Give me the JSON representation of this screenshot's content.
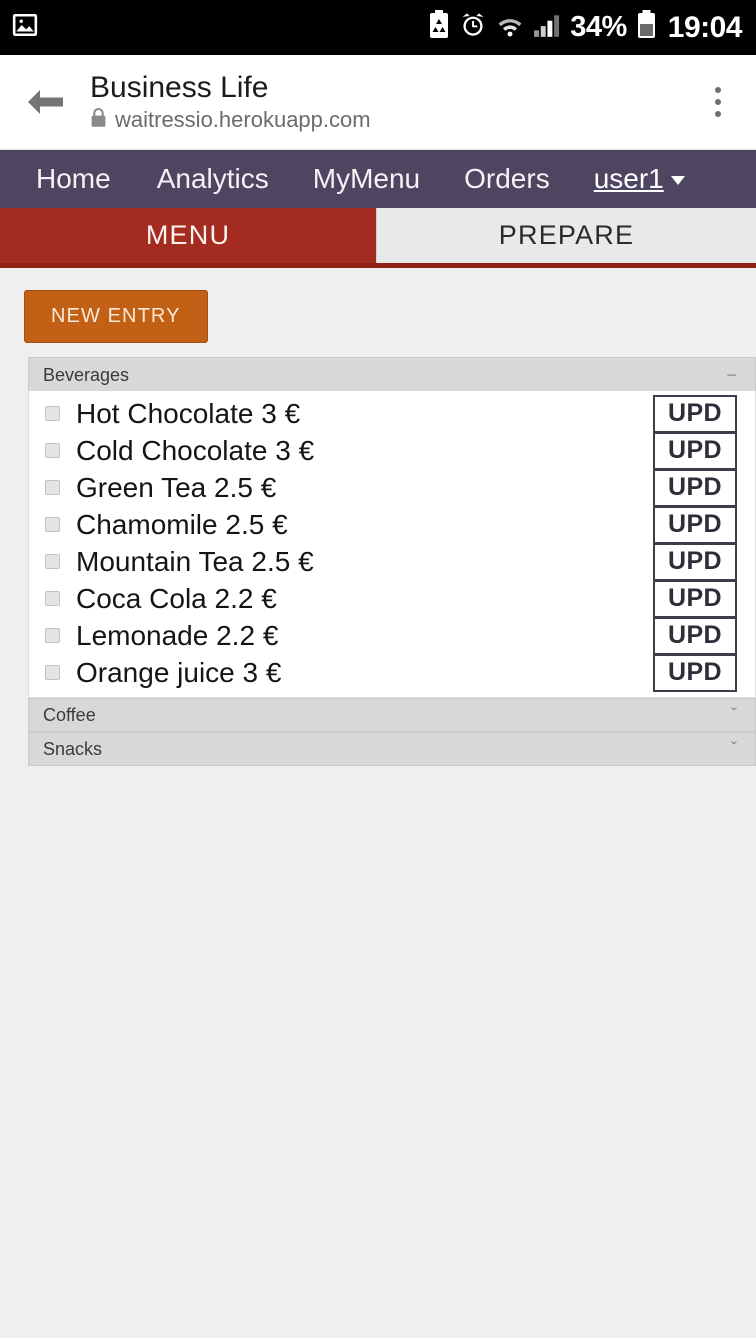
{
  "statusbar": {
    "left_icons": [
      "photo-icon"
    ],
    "battery_saver_icon": "battery-saver-icon",
    "alarm_icon": "alarm-clock-icon",
    "wifi_icon": "wifi-icon",
    "signal_icon": "signal-bars-icon",
    "battery_percent": "34%",
    "battery_icon": "battery-icon",
    "clock": "19:04"
  },
  "browser": {
    "back_icon": "back-arrow-icon",
    "title": "Business Life",
    "lock_icon": "lock-icon",
    "url": "waitressio.herokuapp.com",
    "overflow_icon": "overflow-menu-icon"
  },
  "nav": {
    "items": [
      {
        "label": "Home"
      },
      {
        "label": "Analytics"
      },
      {
        "label": "MyMenu"
      },
      {
        "label": "Orders"
      }
    ],
    "user": {
      "label": "user1",
      "caret_icon": "caret-down-icon"
    },
    "background_color": "#4e4560"
  },
  "tabs": {
    "active_color": "#a42b20",
    "inactive_color": "#e9e9e9",
    "items": [
      {
        "label": "MENU",
        "active": true
      },
      {
        "label": "PREPARE",
        "active": false
      }
    ]
  },
  "toolbar": {
    "new_entry_label": "NEW ENTRY",
    "new_entry_color": "#c26016"
  },
  "panels": [
    {
      "title": "Beverages",
      "expanded": true,
      "toggle_sign": "−",
      "items": [
        {
          "label": "Hot Chocolate 3 €",
          "checked": false,
          "action": "UPD"
        },
        {
          "label": "Cold Chocolate 3 €",
          "checked": false,
          "action": "UPD"
        },
        {
          "label": "Green Tea 2.5 €",
          "checked": false,
          "action": "UPD"
        },
        {
          "label": "Chamomile 2.5 €",
          "checked": false,
          "action": "UPD"
        },
        {
          "label": "Mountain Tea 2.5 €",
          "checked": false,
          "action": "UPD"
        },
        {
          "label": "Coca Cola 2.2 €",
          "checked": false,
          "action": "UPD"
        },
        {
          "label": "Lemonade 2.2 €",
          "checked": false,
          "action": "UPD"
        },
        {
          "label": "Orange juice 3 €",
          "checked": false,
          "action": "UPD"
        }
      ]
    },
    {
      "title": "Coffee",
      "expanded": false,
      "toggle_sign": "ˇ",
      "items": []
    },
    {
      "title": "Snacks",
      "expanded": false,
      "toggle_sign": "ˇ",
      "items": []
    }
  ]
}
